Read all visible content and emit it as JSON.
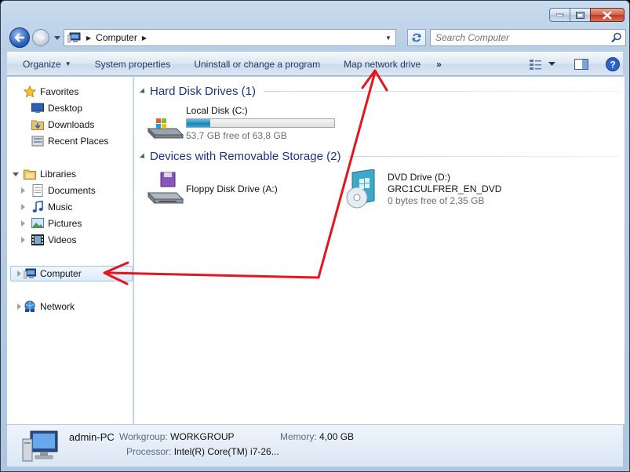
{
  "window": {
    "address_crumb": "Computer",
    "search_placeholder": "Search Computer"
  },
  "command_bar": {
    "organize": "Organize",
    "system_properties": "System properties",
    "uninstall": "Uninstall or change a program",
    "map_network_drive": "Map network drive",
    "more": "»"
  },
  "nav": {
    "favorites": "Favorites",
    "desktop": "Desktop",
    "downloads": "Downloads",
    "recent_places": "Recent Places",
    "libraries": "Libraries",
    "documents": "Documents",
    "music": "Music",
    "pictures": "Pictures",
    "videos": "Videos",
    "computer": "Computer",
    "network": "Network"
  },
  "groups": {
    "hard_disks": "Hard Disk Drives (1)",
    "removable": "Devices with Removable Storage (2)"
  },
  "drives": {
    "local_c": {
      "name": "Local Disk (C:)",
      "free": "53,7 GB free of 63,8 GB",
      "used_fraction": 0.16
    },
    "floppy": {
      "name": "Floppy Disk Drive (A:)"
    },
    "dvd": {
      "name": "DVD Drive (D:)",
      "label": "GRC1CULFRER_EN_DVD",
      "free": "0 bytes free of 2,35 GB"
    }
  },
  "details": {
    "pc_name": "admin-PC",
    "workgroup_label": "Workgroup:",
    "workgroup_value": "WORKGROUP",
    "memory_label": "Memory:",
    "memory_value": "4,00 GB",
    "processor_label": "Processor:",
    "processor_value": "Intel(R) Core(TM) i7-26..."
  },
  "colors": {
    "annotation_red": "#e8141c",
    "group_header": "#1e3287"
  }
}
